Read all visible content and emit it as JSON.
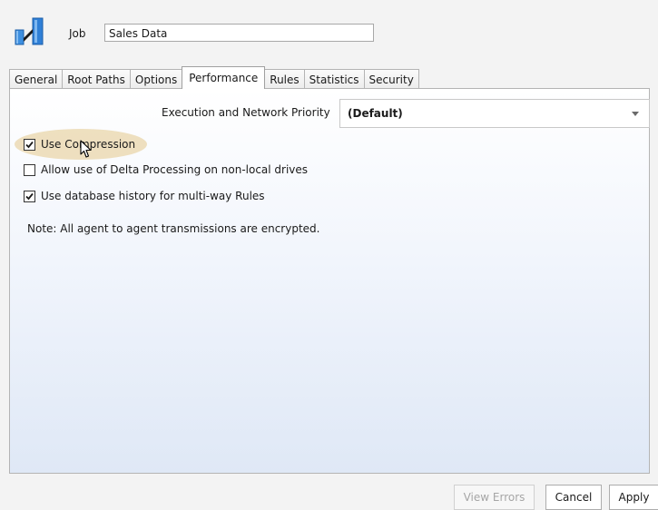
{
  "header": {
    "job_icon": "job-icon",
    "job_label": "Job",
    "job_name": "Sales Data"
  },
  "tabs": [
    {
      "label": "General",
      "active": false
    },
    {
      "label": "Root Paths",
      "active": false
    },
    {
      "label": "Options",
      "active": false
    },
    {
      "label": "Performance",
      "active": true
    },
    {
      "label": "Rules",
      "active": false
    },
    {
      "label": "Statistics",
      "active": false
    },
    {
      "label": "Security",
      "active": false
    }
  ],
  "performance": {
    "priority_label": "Execution and Network Priority",
    "priority_value": "(Default)",
    "options": [
      {
        "label": "Use Compression",
        "checked": true
      },
      {
        "label": "Allow use of Delta Processing on non-local drives",
        "checked": false
      },
      {
        "label": "Use database history for multi-way Rules",
        "checked": true
      }
    ],
    "note": "Note: All agent to agent transmissions are encrypted."
  },
  "buttons": {
    "view_errors": "View Errors",
    "cancel": "Cancel",
    "apply": "Apply"
  },
  "colors": {
    "panel_gradient_bottom": "#dfe8f6",
    "hover_highlight": "#e9d6aa",
    "icon_blue": "#2f7fd6"
  }
}
